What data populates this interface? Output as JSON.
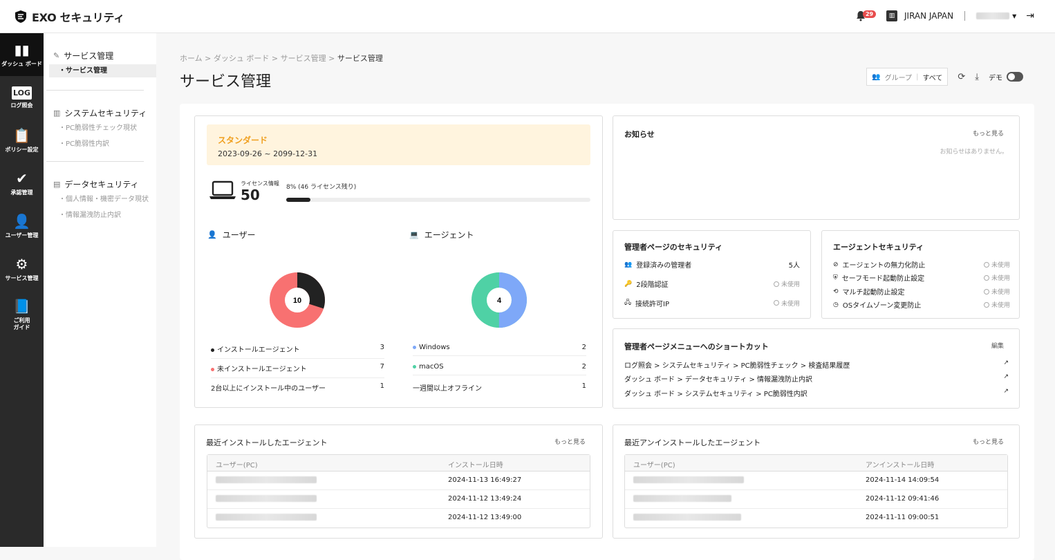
{
  "header": {
    "brand": "EXO セキュリティ",
    "notification_count": "29",
    "org_name": "JIRAN JAPAN"
  },
  "leftnav": [
    {
      "label": "ダッシュ ボード",
      "icon": "bar-chart-icon"
    },
    {
      "label": "ログ照会",
      "icon": "log-icon"
    },
    {
      "label": "ポリシー設定",
      "icon": "clipboard-icon"
    },
    {
      "label": "承認管理",
      "icon": "check-circle-icon"
    },
    {
      "label": "ユーザー管理",
      "icon": "user-plus-icon"
    },
    {
      "label": "サービス管理",
      "icon": "gear-icon"
    },
    {
      "label": "ご利用ガイド",
      "icon": "book-icon"
    }
  ],
  "subnav": {
    "g1": {
      "title": "サービス管理",
      "items": [
        "・サービス管理"
      ]
    },
    "g2": {
      "title": "システムセキュリティ",
      "items": [
        "・PC脆弱性チェック現状",
        "・PC脆弱性内訳"
      ]
    },
    "g3": {
      "title": "データセキュリティ",
      "items": [
        "・個人情報・機密データ現状",
        "・情報漏洩防止内訳"
      ]
    }
  },
  "breadcrumb": {
    "home": "ホーム",
    "dashboard": "ダッシュ ボード",
    "svc": "サービス管理",
    "current": "サービス管理"
  },
  "page_title": "サービス管理",
  "tools": {
    "group_label": "グループ",
    "group_value": "すべて",
    "demo_label": "デモ"
  },
  "license": {
    "plan": "スタンダード",
    "period": "2023-09-26 ~ 2099-12-31",
    "info_label": "ライセンス情報",
    "count": "50",
    "usage_text": "8% (46 ライセンス残り)",
    "usage_percent": 8
  },
  "users": {
    "title": "ユーザー",
    "total": "10",
    "rows": [
      {
        "label": "インストールエージェント",
        "value": "3",
        "color": "#222222"
      },
      {
        "label": "未インストールエージェント",
        "value": "7",
        "color": "#f87171"
      },
      {
        "label": "2台以上にインストール中のユーザー",
        "value": "1",
        "color": ""
      }
    ]
  },
  "agents": {
    "title": "エージェント",
    "total": "4",
    "rows": [
      {
        "label": "Windows",
        "value": "2",
        "color": "#7ea8f8"
      },
      {
        "label": "macOS",
        "value": "2",
        "color": "#4fd1a5"
      },
      {
        "label": "一週間以上オフライン",
        "value": "1",
        "color": ""
      }
    ]
  },
  "notice": {
    "title": "お知らせ",
    "more": "もっと見る",
    "empty": "お知らせはありません。"
  },
  "admin_security": {
    "title": "管理者ページのセキュリティ",
    "rows": [
      {
        "label": "登録済みの管理者",
        "value": "5人"
      },
      {
        "label": "2段階認証",
        "value": "未使用"
      },
      {
        "label": "接続許可IP",
        "value": "未使用"
      }
    ]
  },
  "agent_security": {
    "title": "エージェントセキュリティ",
    "rows": [
      {
        "label": "エージェントの無力化防止",
        "value": "未使用"
      },
      {
        "label": "セーフモード起動防止設定",
        "value": "未使用"
      },
      {
        "label": "マルチ起動防止設定",
        "value": "未使用"
      },
      {
        "label": "OSタイムゾーン変更防止",
        "value": "未使用"
      }
    ]
  },
  "shortcuts": {
    "title": "管理者ページメニューへのショートカット",
    "edit": "編集",
    "rows": [
      "ログ照会 > システムセキュリティ > PC脆弱性チェック > 検査結果履歴",
      "ダッシュ ボード > データセキュリティ > 情報漏洩防止内訳",
      "ダッシュ ボード > システムセキュリティ > PC脆弱性内訳"
    ]
  },
  "recent_install": {
    "title": "最近インストールしたエージェント",
    "more": "もっと見る",
    "col1": "ユーザー(PC)",
    "col2": "インストール日時",
    "rows": [
      "2024-11-13 16:49:27",
      "2024-11-12 13:49:24",
      "2024-11-12 13:49:00"
    ]
  },
  "recent_uninstall": {
    "title": "最近アンインストールしたエージェント",
    "more": "もっと見る",
    "col1": "ユーザー(PC)",
    "col2": "アンインストール日時",
    "rows": [
      "2024-11-14 14:09:54",
      "2024-11-12 09:41:46",
      "2024-11-11 09:00:51"
    ]
  }
}
